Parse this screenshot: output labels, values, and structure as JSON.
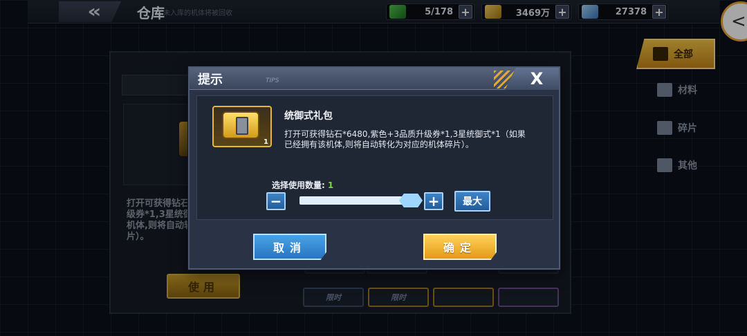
{
  "header": {
    "back_label": "«",
    "title": "仓库",
    "subtitle": "未入库的机体将被回收"
  },
  "resources": [
    {
      "icon": "energy-icon",
      "value": "5/178",
      "color": "#4ec94a"
    },
    {
      "icon": "gold-icon",
      "value": "3469万",
      "color": "#f6d35c"
    },
    {
      "icon": "diamond-icon",
      "value": "27378",
      "color": "#a7d8ff"
    }
  ],
  "side_toggle": "<",
  "filters": {
    "all": "全部",
    "materials": "材料",
    "fragments": "碎片",
    "other": "其他"
  },
  "left_panel": {
    "description": "打开可获得钻石*6480,紫色+3品质升级券*1,3星统御式*1（如果已经拥有该机体,则将自动转化为对应的机体碎片）。",
    "use_label": "使用"
  },
  "grid_tags": {
    "limited": "限时"
  },
  "dialog": {
    "title": "提示",
    "tag": "TIPS",
    "close": "X",
    "item": {
      "name": "统御式礼包",
      "count": "1",
      "description": "打开可获得钻石*6480,紫色+3品质升级券*1,3星统御式*1（如果已经拥有该机体,则将自动转化为对应的机体碎片）。"
    },
    "quantity": {
      "label": "选择使用数量:",
      "value": "1",
      "minus": "−",
      "plus": "+",
      "max": "最大",
      "slider_fraction": 1.0
    },
    "cancel": "取消",
    "confirm": "确定"
  },
  "colors": {
    "accent_gold": "#e8b73a",
    "accent_blue": "#3e84c8",
    "qty_green": "#7bdb3a"
  }
}
